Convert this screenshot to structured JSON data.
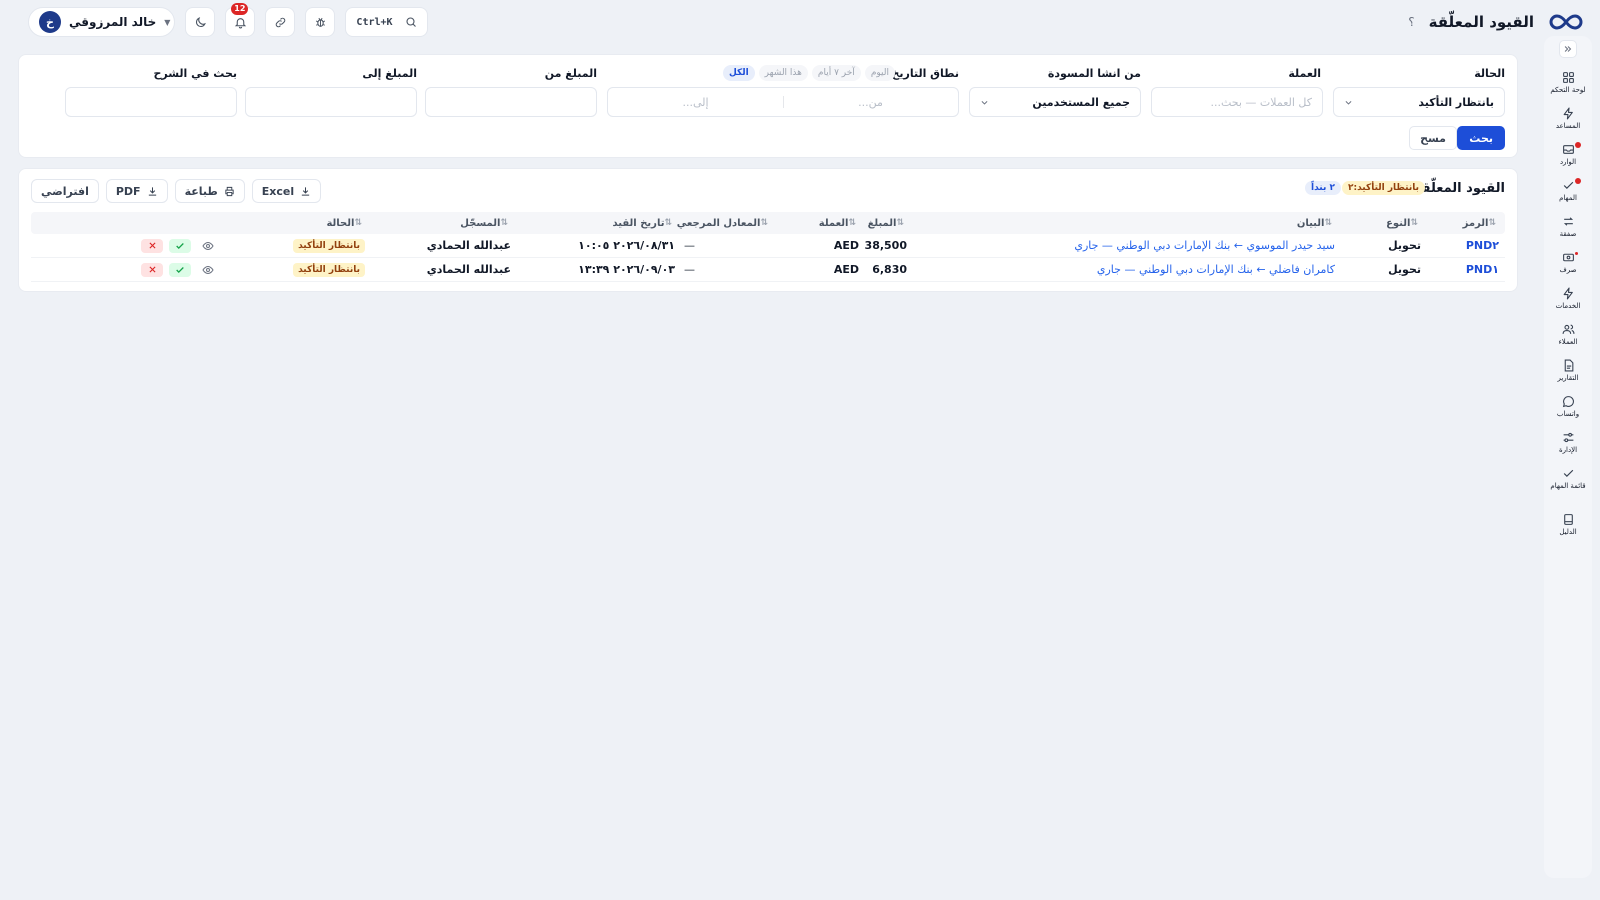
{
  "header": {
    "title": "القيود المعلّقة",
    "help": "؟",
    "search_shortcut": "Ctrl+K",
    "notifications_count": "12",
    "user": {
      "initial": "خ",
      "name": "خالد المرزوقي"
    }
  },
  "sidebar": {
    "items": [
      {
        "label": "لوحة التحكم",
        "icon": "dashboard-icon"
      },
      {
        "label": "المساعد",
        "icon": "bolt-icon"
      },
      {
        "label": "الوارد",
        "icon": "inbox-icon",
        "dot": true
      },
      {
        "label": "المهام",
        "icon": "check-icon",
        "dot": true
      },
      {
        "label": "صفقة",
        "icon": "exchange-icon"
      },
      {
        "label": "صرف",
        "icon": "cash-icon",
        "dot_small": true
      },
      {
        "label": "الخدمات",
        "icon": "bolt-icon"
      },
      {
        "label": "العملاء",
        "icon": "users-icon"
      },
      {
        "label": "التقارير",
        "icon": "report-icon"
      },
      {
        "label": "واتساب",
        "icon": "chat-icon"
      },
      {
        "label": "الإدارة",
        "icon": "sliders-icon"
      },
      {
        "label": "قائمة المهام",
        "icon": "checklist-icon"
      },
      {
        "label": "الدليل",
        "icon": "book-icon"
      }
    ]
  },
  "filters": {
    "status": {
      "label": "الحالة",
      "value": "بانتظار التأكيد"
    },
    "currency": {
      "label": "العملة",
      "placeholder": "كل العملات — بحث..."
    },
    "creator": {
      "label": "من انشا المسودة",
      "value": "جميع المستخدمين"
    },
    "date_range": {
      "label": "نطاق التاريخ",
      "presets": [
        "اليوم",
        "آخر ٧ أيام",
        "هذا الشهر",
        "الكل"
      ],
      "active_preset": "الكل",
      "from_placeholder": "من...",
      "to_placeholder": "إلى..."
    },
    "amount_from": {
      "label": "المبلغ من"
    },
    "amount_to": {
      "label": "المبلغ إلى"
    },
    "description_search": {
      "label": "بحث في الشرح"
    },
    "search_button": "بحث",
    "clear_button": "مسح"
  },
  "results": {
    "title": "القيود المعلّقة",
    "pending_badge": "بانتظار التأكيد:٢",
    "count_badge": "٢ بنداً",
    "tools": {
      "excel": "Excel",
      "print": "طباعة",
      "pdf": "PDF",
      "default": "افتراضي"
    },
    "columns": {
      "code": "الرمز",
      "type": "النوع",
      "description": "البيان",
      "amount": "المبلغ",
      "currency": "العملة",
      "ref_equiv": "المعادل المرجعي",
      "entry_date": "تاريخ القيد",
      "recorder": "المسجّل",
      "status": "الحالة"
    },
    "rows": [
      {
        "code": "PND٢",
        "type": "تحويل",
        "description": "سيد حيدر الموسوي ← بنك الإمارات دبي الوطني — جاري",
        "amount": "38,500",
        "currency": "AED",
        "ref_equiv": "—",
        "entry_date": "٢٠٢٦/٠٨/٣١ ١٠:٠٥",
        "recorder": "عبدالله الحمادي",
        "status": "بانتظار التأكيد"
      },
      {
        "code": "PND١",
        "type": "تحويل",
        "description": "كامران فاضلي ← بنك الإمارات دبي الوطني — جاري",
        "amount": "6,830",
        "currency": "AED",
        "ref_equiv": "—",
        "entry_date": "٢٠٢٦/٠٩/٠٣ ١٣:٣٩",
        "recorder": "عبدالله الحمادي",
        "status": "بانتظار التأكيد"
      }
    ]
  }
}
